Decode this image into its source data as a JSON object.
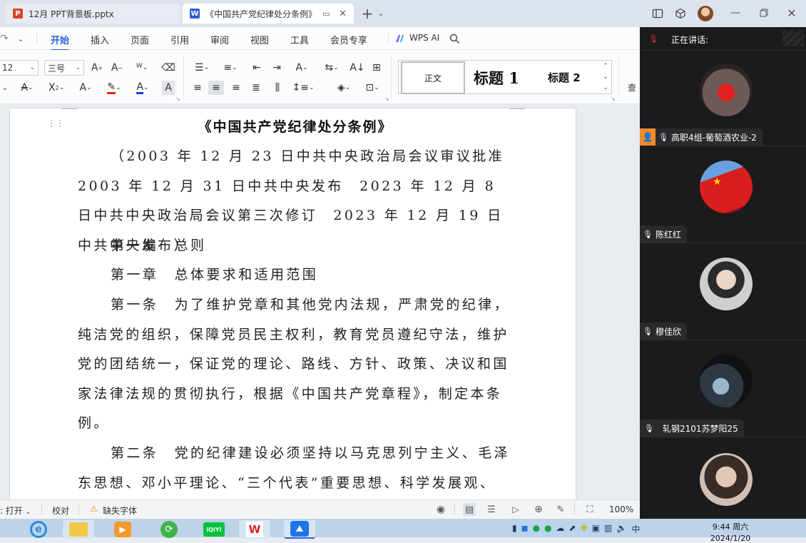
{
  "tabs": [
    {
      "icon_letter": "P",
      "title": "12月 PPT背景板.pptx"
    },
    {
      "icon_letter": "W",
      "title": "《中国共产党纪律处分条例》"
    }
  ],
  "menu": [
    "开始",
    "插入",
    "页面",
    "引用",
    "审阅",
    "视图",
    "工具",
    "会员专享",
    "WPS AI"
  ],
  "ribbon": {
    "font_size_value": "12",
    "font_size_cn": "三号",
    "styles": {
      "normal": "正文",
      "h1": "标题 1",
      "h2": "标题 2",
      "search_cut": "查"
    }
  },
  "document": {
    "title": "《中国共产党纪律处分条例》",
    "paragraphs": [
      "（2003 年 12 月 23 日中共中央政治局会议审议批准　2003 年 12 月 31 日中共中央发布　2023 年 12 月 8 日中共中央政治局会议第三次修订　2023 年 12 月 19 日中共中央发布）",
      "第一编　总则",
      "第一章　总体要求和适用范围",
      "第一条　为了维护党章和其他党内法规，严肃党的纪律，纯洁党的组织，保障党员民主权利，教育党员遵纪守法，维护党的团结统一，保证党的理论、路线、方针、政策、决议和国家法律法规的贯彻执行，根据《中国共产党章程》，制定本条例。",
      "第二条　党的纪律建设必须坚持以马克思列宁主义、毛泽东思想、邓小平理论、“三个代表”重要思想、科学发展观、"
    ]
  },
  "statusbar": {
    "left_cut": ": 打开",
    "proofread": "校对",
    "missing_font": "缺失字体",
    "zoom": "100%"
  },
  "meeting": {
    "speaking_label": "正在讲话:",
    "participants": [
      {
        "name": "高职4组-葡萄酒农业-2"
      },
      {
        "name": "陈红红"
      },
      {
        "name": "穆佳欣"
      },
      {
        "name": "轧钢2101苏梦阳25"
      },
      {
        "name": ""
      }
    ]
  },
  "clock": {
    "time": "9:44 周六",
    "date": "2024/1/20"
  },
  "colors": {
    "accent": "#2a63d8",
    "ppt": "#d24726",
    "wps": "#2b5fd9",
    "panel": "#1b1b1d"
  }
}
